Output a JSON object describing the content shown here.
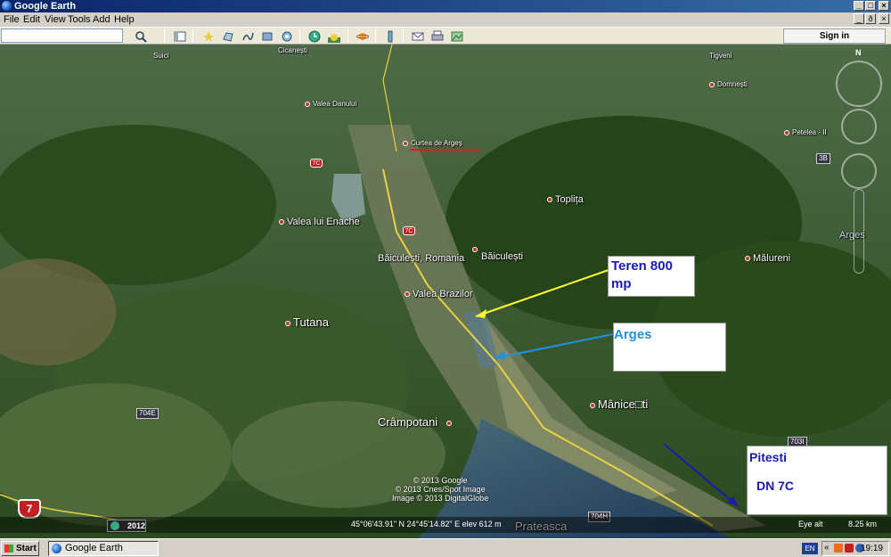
{
  "window": {
    "title": "Google Earth",
    "minimize": "_",
    "maximize": "□",
    "close": "×"
  },
  "menu": [
    "File",
    "Edit",
    "View",
    "Tools",
    "Add",
    "Help"
  ],
  "menu_buttons": {
    "minimize": "_",
    "restore": "ð",
    "close": "×"
  },
  "toolbar": {
    "search_value": "",
    "signin_label": "Sign in",
    "icons": [
      "search-icon",
      "sidebar-toggle-icon",
      "placemark-icon",
      "polygon-icon",
      "path-icon",
      "overlay-icon",
      "tour-icon",
      "historical-imagery-icon",
      "sunlight-icon",
      "planets-icon",
      "ruler-icon",
      "email-icon",
      "print-icon",
      "save-image-icon"
    ]
  },
  "map": {
    "places": [
      {
        "name": "Curtea de Argeș",
        "kind": "small"
      },
      {
        "name": "Valea Danului",
        "kind": "small"
      },
      {
        "name": "Cicanești",
        "kind": "small"
      },
      {
        "name": "Suici",
        "kind": "small"
      },
      {
        "name": "Domnești",
        "kind": "small"
      },
      {
        "name": "Tigveni",
        "kind": "small"
      },
      {
        "name": "Petelea - II",
        "kind": "small"
      },
      {
        "name": "Toplița",
        "kind": "normal"
      },
      {
        "name": "Valea lui Enache",
        "kind": "normal"
      },
      {
        "name": "Băiculești, Romania",
        "kind": "normal"
      },
      {
        "name": "Băiculești",
        "kind": "normal"
      },
      {
        "name": "Valea Brazilor",
        "kind": "normal"
      },
      {
        "name": "Tutana",
        "kind": "normal"
      },
      {
        "name": "Mălureni",
        "kind": "normal"
      },
      {
        "name": "Arges",
        "kind": "normal"
      },
      {
        "name": "Mânice□ti",
        "kind": "big"
      },
      {
        "name": "Crâmpotani",
        "kind": "big"
      },
      {
        "name": "Prateasca",
        "kind": "big"
      }
    ],
    "road_shields": {
      "r1": "7C",
      "r2": "7C",
      "r3": "704E",
      "r4": "704H",
      "r5": "703I",
      "r6": "7",
      "r7": "3B"
    },
    "annotations": {
      "teren": "Teren 800 mp",
      "teren_line1": "Teren 800",
      "teren_line2": "mp",
      "arges": "Arges",
      "pitesti": "Pitesti",
      "dn7c": "DN 7C"
    },
    "credits": [
      "© 2013 Google",
      "© 2013 Cnes/Spot Image",
      "Image © 2013 DigitalGlobe"
    ],
    "status": {
      "coords": "45°06'43.91\" N   24°45'14.82\" E  elev   612 m",
      "eye_alt_label": "Eye alt",
      "eye_alt": "8.25 km",
      "year": "2012"
    },
    "compass": "N"
  },
  "taskbar": {
    "start": "Start",
    "task": "Google Earth",
    "lang": "EN",
    "clock": "19:19",
    "arrows": "«"
  },
  "colors": {
    "titlebar": "#0a246a",
    "annotation_blue": "#1a1ab0",
    "annotation_light_blue": "#2090e0",
    "yellow_line": "#ffff30",
    "red_underline": "#d02020"
  }
}
